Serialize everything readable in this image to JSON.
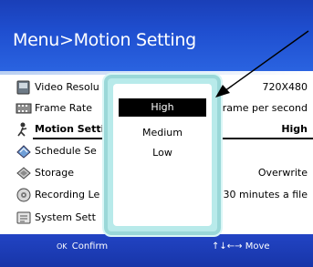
{
  "header": {
    "title": "Menu>Motion Setting"
  },
  "menu": {
    "items": [
      {
        "label": "Video Resolu",
        "value": "720X480",
        "icon": "video-icon"
      },
      {
        "label": "Frame Rate",
        "value": "rame per second",
        "icon": "film-icon"
      },
      {
        "label": "Motion Setti",
        "value": "High",
        "icon": "motion-icon"
      },
      {
        "label": "Schedule Se",
        "value": "",
        "icon": "schedule-icon"
      },
      {
        "label": "Storage",
        "value": "Overwrite",
        "icon": "storage-icon"
      },
      {
        "label": "Recording Le",
        "value": "30 minutes a file",
        "icon": "recording-icon"
      },
      {
        "label": "System Sett",
        "value": "",
        "icon": "system-icon"
      }
    ],
    "selected_index": 2
  },
  "popup": {
    "options": [
      "High",
      "Medium",
      "Low"
    ],
    "selected": "High"
  },
  "footer": {
    "ok_key": "OK",
    "confirm_label": "Confirm",
    "nav_keys": "↑↓←→",
    "move_label": "Move"
  },
  "colors": {
    "header_blue": "#1f4fd0",
    "footer_blue": "#1735a8",
    "popup_teal": "#b8eaea",
    "arrow": "#000000"
  }
}
